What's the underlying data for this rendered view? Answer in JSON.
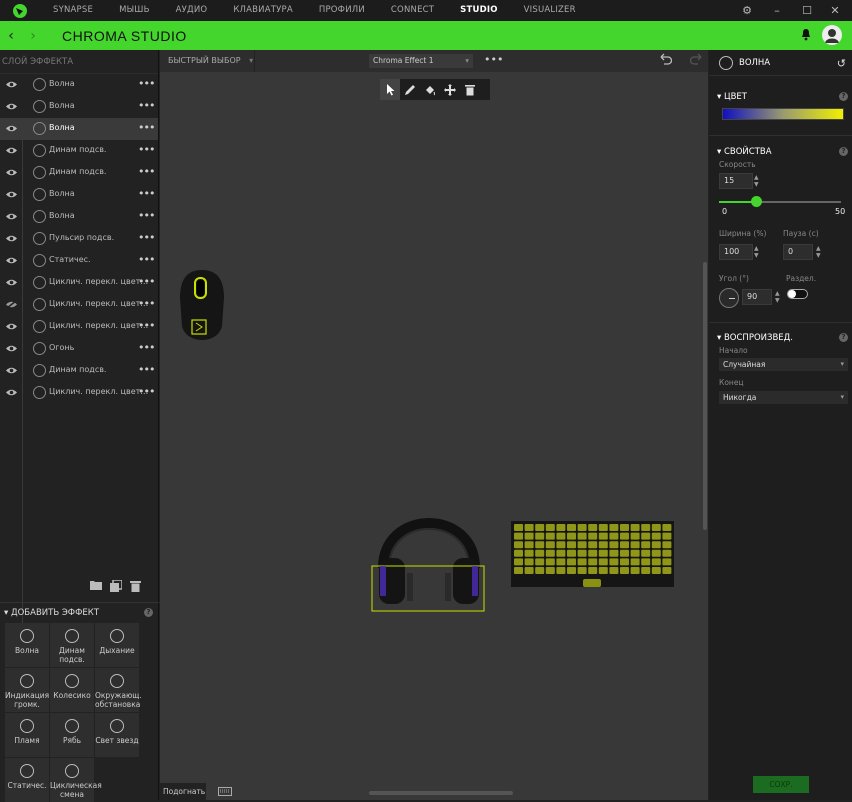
{
  "nav": {
    "items": [
      "SYNAPSE",
      "МЫШЬ",
      "АУДИО",
      "КЛАВИАТУРА",
      "ПРОФИЛИ",
      "CONNECT",
      "STUDIO",
      "VISUALIZER"
    ],
    "active": "STUDIO"
  },
  "header": {
    "title": "CHROMA STUDIO",
    "accent": "#44d62c"
  },
  "left": {
    "title": "СЛОЙ ЭФФЕКТА",
    "layers": [
      {
        "name": "Волна",
        "selected": false,
        "hidden": false
      },
      {
        "name": "Волна",
        "selected": false,
        "hidden": false
      },
      {
        "name": "Волна",
        "selected": true,
        "hidden": false
      },
      {
        "name": "Динам подсв.",
        "selected": false,
        "hidden": false
      },
      {
        "name": "Динам подсв.",
        "selected": false,
        "hidden": false
      },
      {
        "name": "Волна",
        "selected": false,
        "hidden": false
      },
      {
        "name": "Волна",
        "selected": false,
        "hidden": false
      },
      {
        "name": "Пульсир подсв.",
        "selected": false,
        "hidden": false
      },
      {
        "name": "Статичес.",
        "selected": false,
        "hidden": false
      },
      {
        "name": "Циклич. перекл. цвет…",
        "selected": false,
        "hidden": false
      },
      {
        "name": "Циклич. перекл. цвет…",
        "selected": false,
        "hidden": true
      },
      {
        "name": "Циклич. перекл. цвет…",
        "selected": false,
        "hidden": false
      },
      {
        "name": "Огонь",
        "selected": false,
        "hidden": false
      },
      {
        "name": "Динам подсв.",
        "selected": false,
        "hidden": false
      },
      {
        "name": "Циклич. перекл. цвет…",
        "selected": false,
        "hidden": false
      }
    ],
    "add_effect": {
      "title": "ДОБАВИТЬ ЭФФЕКТ",
      "effects": [
        "Волна",
        "Динам подсв.",
        "Дыхание",
        "Индикация громк.",
        "Колесико",
        "Окружающ. обстановка",
        "Пламя",
        "Рябь",
        "Свет звезд",
        "Статичес.",
        "Циклическая смена"
      ]
    }
  },
  "canvas": {
    "quick_select": "БЫСТРЫЙ ВЫБОР",
    "effect_name": "Chroma Effect 1",
    "preview_label": "Подогнать"
  },
  "right": {
    "title": "ВОЛНА",
    "color_section": "ЦВЕТ",
    "properties_section": "СВОЙСТВА",
    "speed_label": "Скорость",
    "speed_value": "15",
    "slider_min": "0",
    "slider_max": "50",
    "speed_fraction": 0.3,
    "width_label": "Ширина (%)",
    "width_value": "100",
    "pause_label": "Пауза (с)",
    "pause_value": "0",
    "angle_label": "Угол (°)",
    "angle_value": "90",
    "split_label": "Раздел.",
    "playback_section": "ВОСПРОИЗВЕД.",
    "start_label": "Начало",
    "start_value": "Случайная",
    "end_label": "Конец",
    "end_value": "Никогда",
    "save_label": "СОХР."
  }
}
